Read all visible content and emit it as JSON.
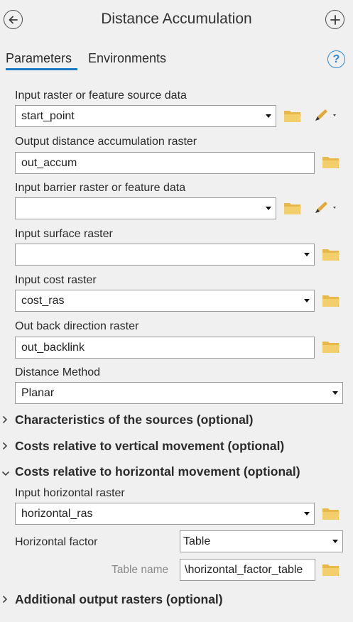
{
  "header": {
    "title": "Distance Accumulation",
    "back_icon": "back-arrow-icon",
    "add_icon": "add-icon"
  },
  "tabs": [
    {
      "label": "Parameters",
      "active": true
    },
    {
      "label": "Environments",
      "active": false
    }
  ],
  "help_glyph": "?",
  "params": {
    "input_source": {
      "label": "Input raster or feature source data",
      "value": "start_point"
    },
    "output_accum": {
      "label": "Output distance accumulation raster",
      "value": "out_accum"
    },
    "barrier": {
      "label": "Input barrier raster or feature data",
      "value": ""
    },
    "surface": {
      "label": "Input surface raster",
      "value": ""
    },
    "cost": {
      "label": "Input cost raster",
      "value": "cost_ras"
    },
    "backlink": {
      "label": "Out back direction raster",
      "value": "out_backlink"
    },
    "distance_method": {
      "label": "Distance Method",
      "value": "Planar"
    }
  },
  "sections": {
    "characteristics": "Characteristics of the sources (optional)",
    "vertical": "Costs relative to vertical movement (optional)",
    "horizontal": "Costs relative to horizontal movement (optional)",
    "additional": "Additional output rasters (optional)"
  },
  "horizontal": {
    "raster_label": "Input horizontal raster",
    "raster_value": "horizontal_ras",
    "factor_label": "Horizontal factor",
    "factor_value": "Table",
    "table_label": "Table name",
    "table_value": "\\horizontal_factor_table"
  },
  "colors": {
    "accent": "#1a79c0",
    "folder": "#e8b84a",
    "background": "#f0f0f0"
  }
}
